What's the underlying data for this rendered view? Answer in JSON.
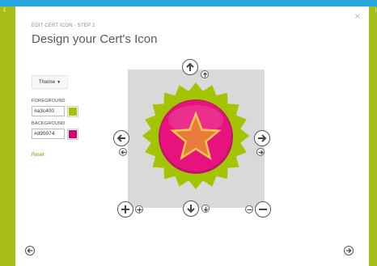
{
  "window": {
    "step_number": "1"
  },
  "header": {
    "step_label": "EDIT CERT ICON - STEP 2",
    "title": "Design your Cert's Icon"
  },
  "controls": {
    "theme_label": "Theme",
    "foreground": {
      "label": "FOREGROUND",
      "value": "#a3c400",
      "color": "#a3c400"
    },
    "background": {
      "label": "BACKGROUND",
      "value": "#d90074",
      "color": "#d90074"
    },
    "reset_label": "Reset"
  },
  "icon": {
    "badge_color": "#a3c400",
    "circle_color": "#e8127f",
    "star_fill": "#e87c3c",
    "star_stroke": "#f3c94a",
    "background_color": "#d9d9d9"
  },
  "icons": {
    "close": "close-icon",
    "move_up": "arrow-up-icon",
    "move_down": "arrow-down-icon",
    "move_left": "arrow-left-icon",
    "move_right": "arrow-right-icon",
    "zoom_in": "plus-icon",
    "zoom_out": "minus-icon",
    "back": "back-arrow-icon",
    "next": "forward-arrow-icon"
  },
  "colors": {
    "accent_bar": "#29a8e0",
    "side_bar": "#a6bd1a",
    "reset_link": "#6ba100"
  }
}
